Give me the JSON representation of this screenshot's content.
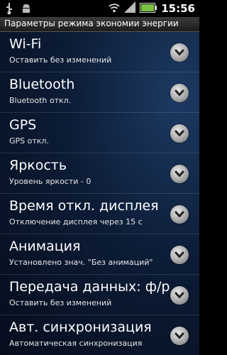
{
  "status_bar": {
    "time": "15:56",
    "icons": [
      "usb-icon",
      "android-debug-icon",
      "wifi-icon",
      "signal-icon",
      "battery-icon"
    ]
  },
  "header": {
    "title": "Параметры режима экономии энергии"
  },
  "settings": [
    {
      "title": "Wi-Fi",
      "subtitle": "Оставить без изменений"
    },
    {
      "title": "Bluetooth",
      "subtitle": "Bluetooth откл."
    },
    {
      "title": "GPS",
      "subtitle": "GPS откл."
    },
    {
      "title": "Яркость",
      "subtitle": "Уровень яркости - 0"
    },
    {
      "title": "Время откл. дисплея",
      "subtitle": "Отключение дисплея через 15 с"
    },
    {
      "title": "Анимация",
      "subtitle": "Установлено знач. \"Без анимаций\""
    },
    {
      "title": "Передача данных: ф/р",
      "subtitle": "Оставить без изменений"
    },
    {
      "title": "Авт. синхронизация",
      "subtitle": "Автоматическая синхронизация"
    }
  ]
}
